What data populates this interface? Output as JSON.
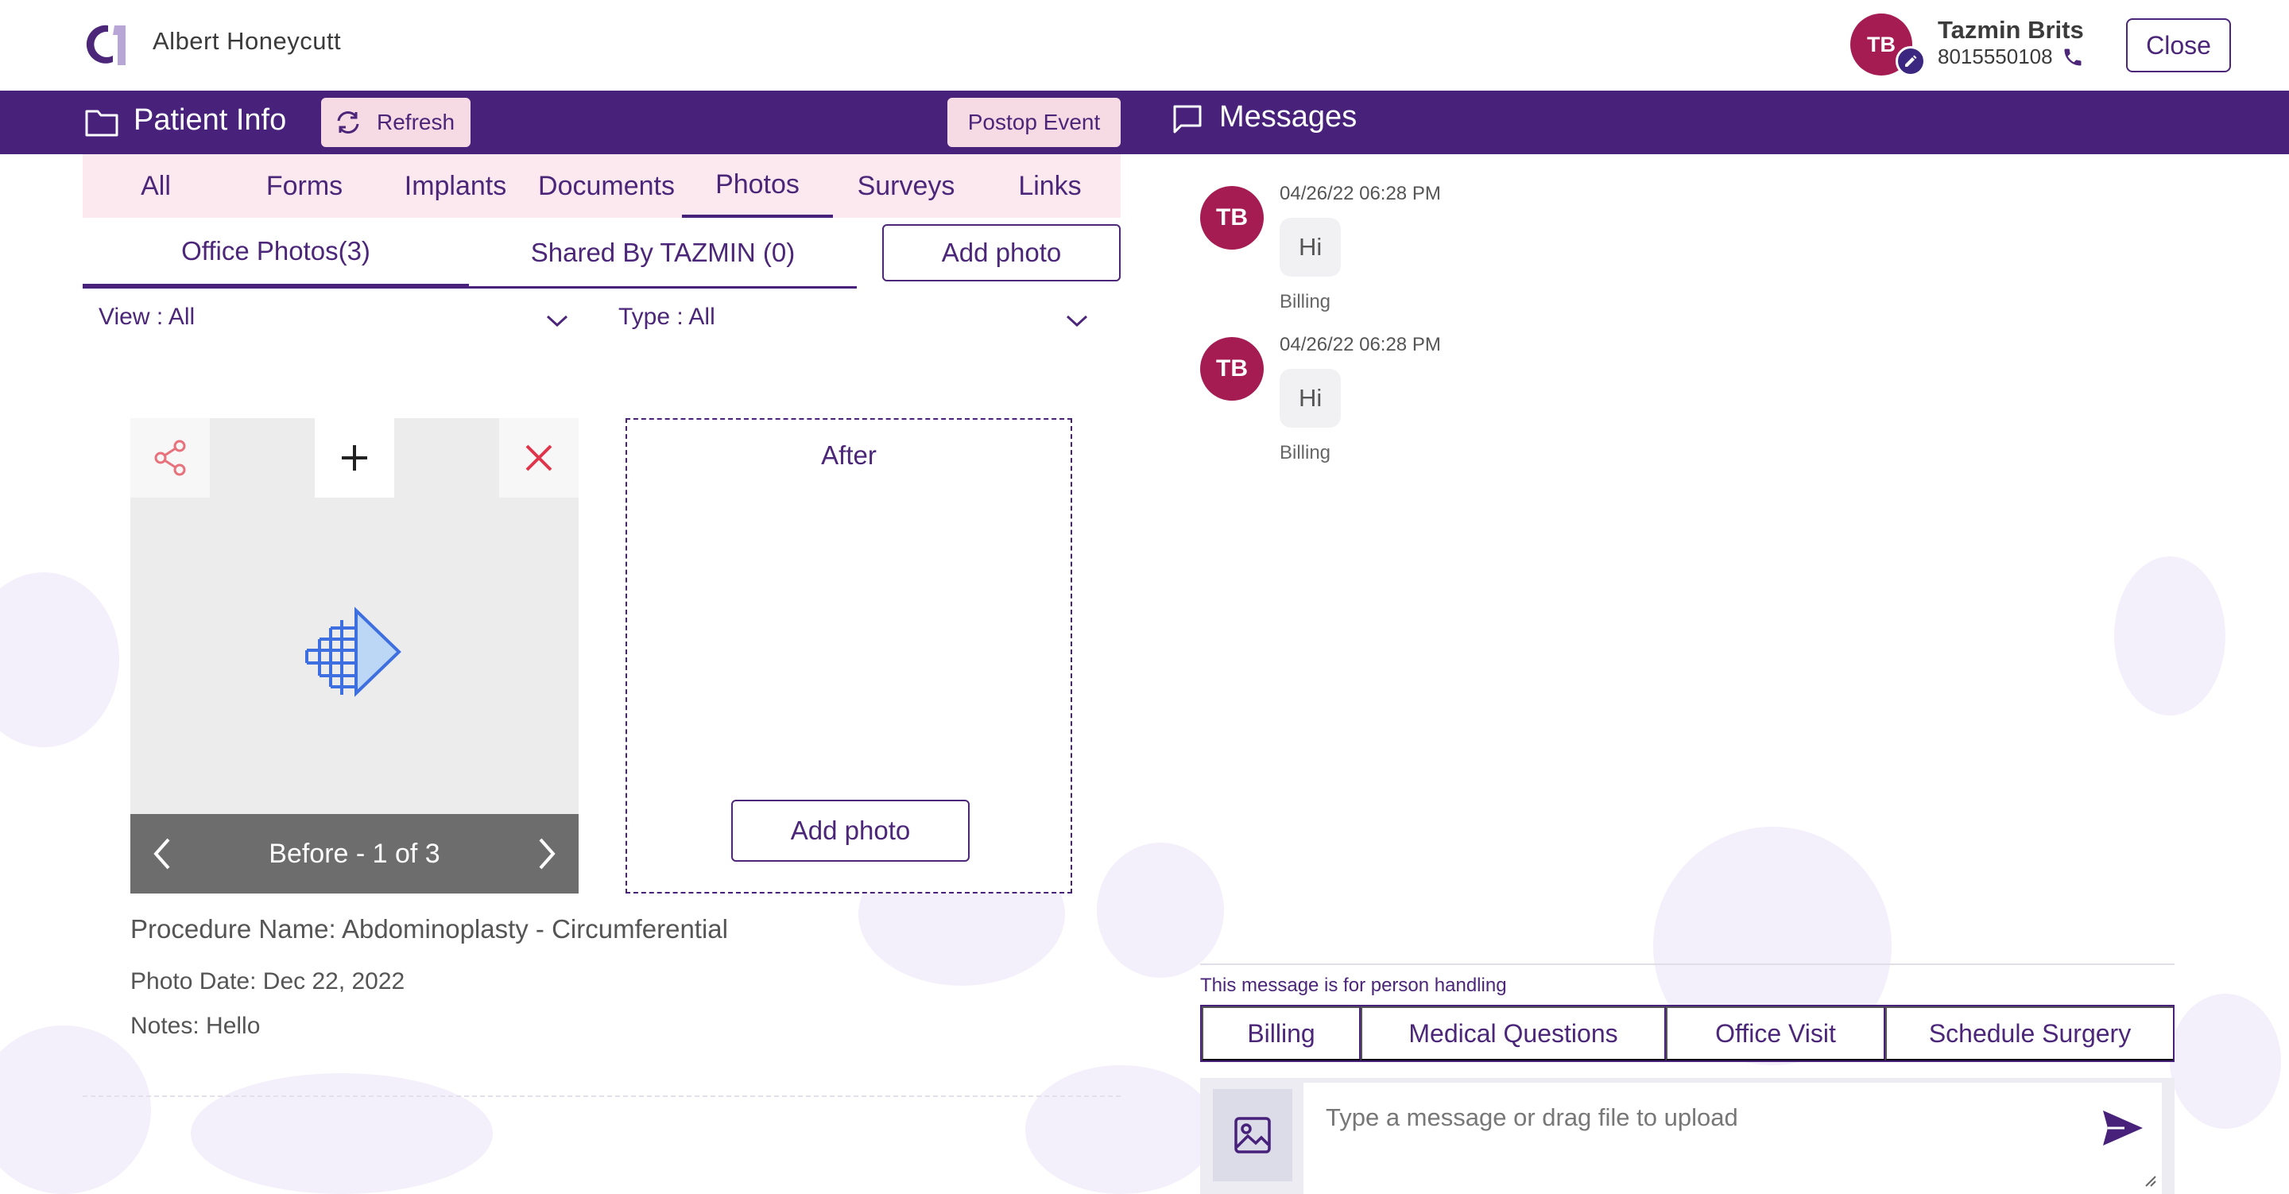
{
  "header": {
    "patient_name": "Albert Honeycutt",
    "user": {
      "initials": "TB",
      "name": "Tazmin Brits",
      "phone": "8015550108"
    },
    "close_label": "Close"
  },
  "toolbar": {
    "patient_info_title": "Patient Info",
    "refresh_label": "Refresh",
    "postop_label": "Postop Event",
    "messages_title": "Messages"
  },
  "tabs": [
    {
      "label": "All"
    },
    {
      "label": "Forms"
    },
    {
      "label": "Implants"
    },
    {
      "label": "Documents"
    },
    {
      "label": "Photos",
      "active": true
    },
    {
      "label": "Surveys"
    },
    {
      "label": "Links"
    }
  ],
  "subtabs": {
    "office_photos": "Office Photos(3)",
    "shared": "Shared By TAZMIN (0)",
    "add_photo": "Add photo"
  },
  "filters": {
    "view": "View : All",
    "type": "Type : All"
  },
  "photo": {
    "caption": "Before - 1 of 3",
    "after_label": "After",
    "after_add_photo": "Add photo",
    "procedure": "Procedure Name: Abdominoplasty - Circumferential",
    "date": "Photo Date: Dec 22, 2022",
    "notes": "Notes: Hello"
  },
  "messages": [
    {
      "initials": "TB",
      "time": "04/26/22 06:28 PM",
      "text": "Hi",
      "tag": "Billing"
    },
    {
      "initials": "TB",
      "time": "04/26/22 06:28 PM",
      "text": "Hi",
      "tag": "Billing"
    }
  ],
  "handling": {
    "label": "This message is for person handling",
    "options": [
      "Billing",
      "Medical Questions",
      "Office Visit",
      "Schedule Surgery"
    ]
  },
  "composer": {
    "placeholder": "Type a message or drag file to upload"
  },
  "colors": {
    "primary": "#47217a",
    "accent": "#a51c52",
    "pink_button": "#f6dbe4",
    "delete": "#e0344a",
    "share": "#e8727c"
  }
}
